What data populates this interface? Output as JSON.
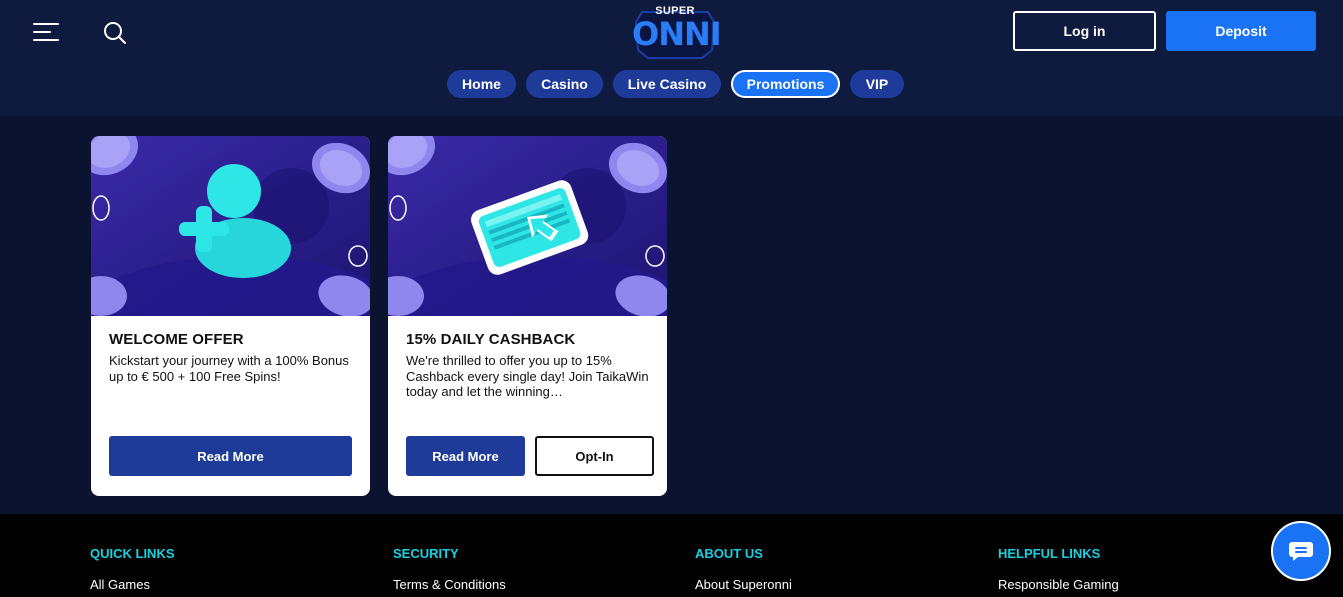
{
  "header": {
    "logo": {
      "top_text": "SUPER",
      "main_text": "ONNI"
    },
    "login_label": "Log in",
    "deposit_label": "Deposit"
  },
  "nav": {
    "items": [
      {
        "label": "Home",
        "active": false
      },
      {
        "label": "Casino",
        "active": false
      },
      {
        "label": "Live Casino",
        "active": false
      },
      {
        "label": "Promotions",
        "active": true
      },
      {
        "label": "VIP",
        "active": false
      }
    ]
  },
  "promotions": [
    {
      "title": "WELCOME OFFER",
      "description": "Kickstart your journey with a 100% Bonus up to € 500 + 100 Free Spins!",
      "read_more_label": "Read More",
      "icon": "add-user-icon"
    },
    {
      "title": "15% DAILY CASHBACK",
      "description": "We're thrilled to offer you up to 15% Cashback every single day! Join TaikaWin today and let the winning…",
      "read_more_label": "Read More",
      "optin_label": "Opt-In",
      "icon": "cashback-money-icon"
    }
  ],
  "footer": {
    "columns": [
      {
        "heading": "QUICK LINKS",
        "first_link": "All Games"
      },
      {
        "heading": "SECURITY",
        "first_link": "Terms & Conditions"
      },
      {
        "heading": "ABOUT US",
        "first_link": "About Superonni"
      },
      {
        "heading": "HELPFUL LINKS",
        "first_link": "Responsible Gaming"
      }
    ]
  },
  "colors": {
    "page_bg": "#0c1330",
    "header_bg": "#0f1a3f",
    "nav_pill": "#1f3b9a",
    "accent_blue": "#1a73f5",
    "footer_heading": "#18d0e0",
    "promo_art_bg": "#2e1f8a",
    "promo_icon": "#2ee6e6"
  }
}
